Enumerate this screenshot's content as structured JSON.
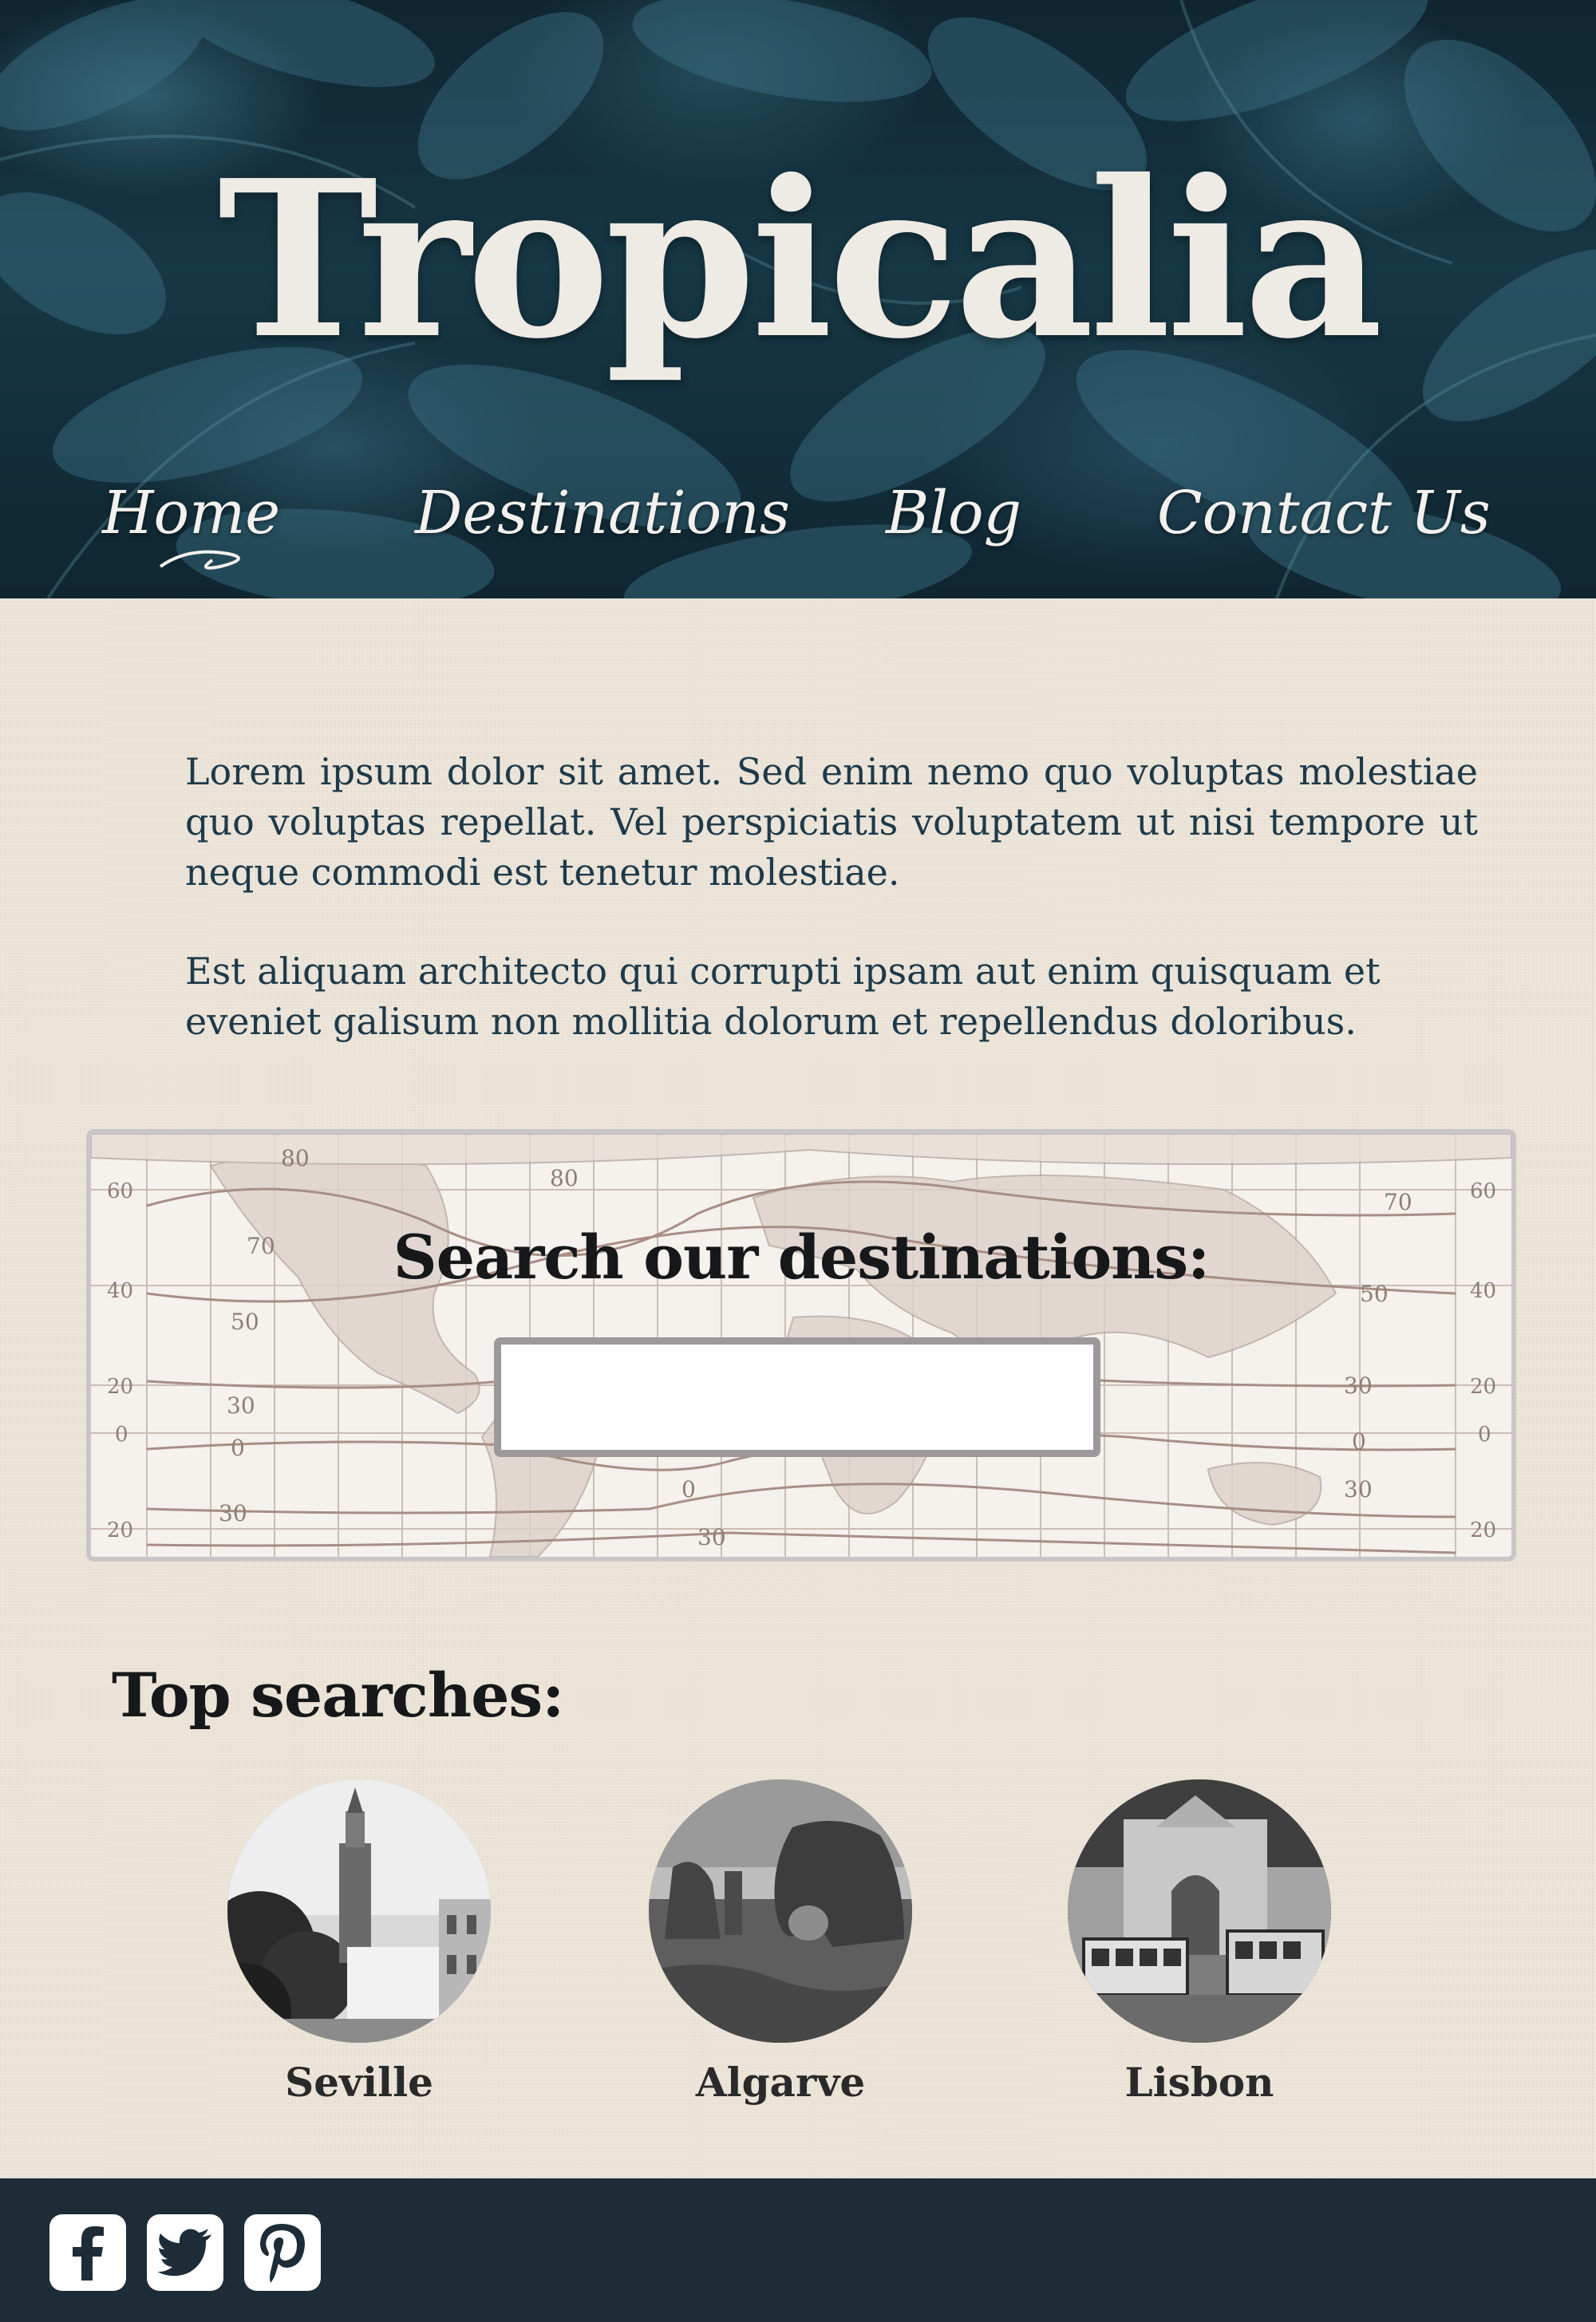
{
  "header": {
    "brand": "Tropicalia",
    "nav": [
      {
        "label": "Home"
      },
      {
        "label": "Destinations"
      },
      {
        "label": "Blog"
      },
      {
        "label": "Contact Us"
      }
    ]
  },
  "intro": {
    "paragraph1": "Lorem ipsum dolor sit amet. Sed enim nemo quo voluptas molestiae quo voluptas repellat. Vel perspiciatis voluptatem ut nisi tempore ut neque commodi est tenetur molestiae.",
    "paragraph2": "Est aliquam architecto qui corrupti ipsam aut enim quisquam et eveniet galisum non mollitia dolorum et repellendus doloribus."
  },
  "search": {
    "heading": "Search our destinations:",
    "value": "",
    "map_labels": {
      "left_lat": [
        "60",
        "40",
        "20",
        "0",
        "20"
      ],
      "right_lat": [
        "60",
        "40",
        "20",
        "0",
        "20"
      ],
      "isotherms": [
        "80",
        "80",
        "70",
        "70",
        "50",
        "50",
        "30",
        "30",
        "30",
        "0",
        "0",
        "0",
        "30",
        "30"
      ]
    }
  },
  "top_searches": {
    "heading": "Top searches:",
    "items": [
      {
        "label": "Seville"
      },
      {
        "label": "Algarve"
      },
      {
        "label": "Lisbon"
      }
    ]
  },
  "footer": {
    "social": [
      {
        "icon": "facebook-icon"
      },
      {
        "icon": "twitter-icon"
      },
      {
        "icon": "pinterest-icon"
      }
    ]
  },
  "colors": {
    "hero_dark": "#163744",
    "text_navy": "#1d3a4a",
    "paper": "#ebe3d7",
    "footer": "#1d2c36",
    "map_line": "#a88e86"
  }
}
